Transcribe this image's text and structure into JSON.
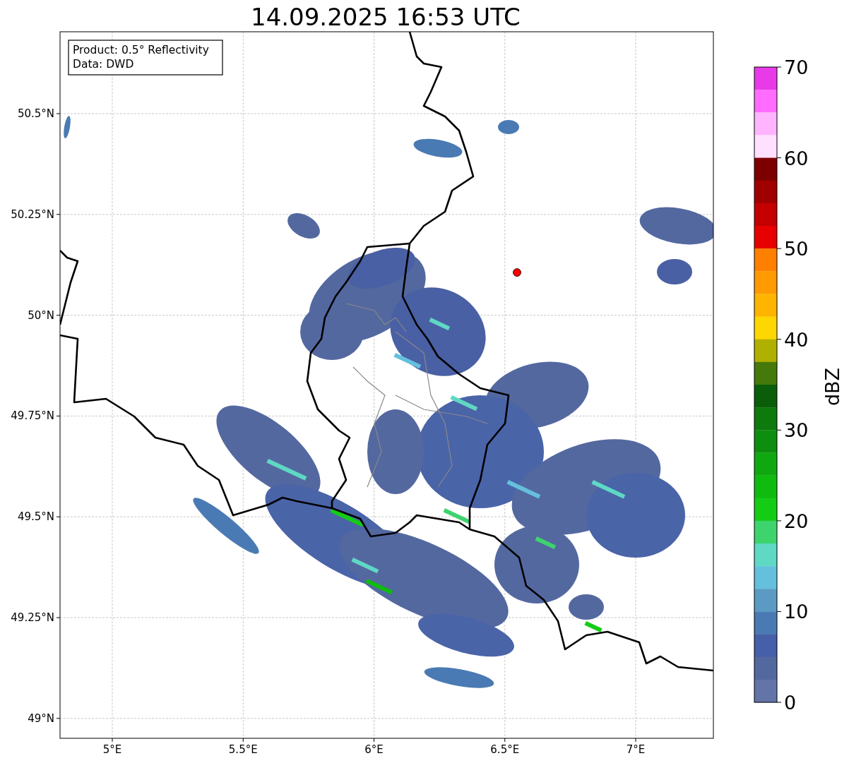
{
  "title": "14.09.2025 16:53 UTC",
  "info_box": [
    "Product: 0.5° Reflectivity",
    "Data: DWD"
  ],
  "x_ticks": [
    "5°E",
    "5.5°E",
    "6°E",
    "6.5°E",
    "7°E"
  ],
  "y_ticks": [
    "50.5°N",
    "50.25°N",
    "50°N",
    "49.75°N",
    "49.5°N",
    "49.25°N",
    "49°N"
  ],
  "colorbar": {
    "label": "dBZ",
    "ticks": [
      "70",
      "60",
      "50",
      "40",
      "30",
      "20",
      "10",
      "0"
    ],
    "bins": [
      {
        "color": "#e83ae8"
      },
      {
        "color": "#ff6cff"
      },
      {
        "color": "#ffb4ff"
      },
      {
        "color": "#ffe0ff"
      },
      {
        "color": "#7d0000"
      },
      {
        "color": "#a00000"
      },
      {
        "color": "#c40000"
      },
      {
        "color": "#e60000"
      },
      {
        "color": "#ff7f00"
      },
      {
        "color": "#ff9a00"
      },
      {
        "color": "#ffb400"
      },
      {
        "color": "#ffd700"
      },
      {
        "color": "#b0b000"
      },
      {
        "color": "#457a0a"
      },
      {
        "color": "#0a5e0a"
      },
      {
        "color": "#0c7a0c"
      },
      {
        "color": "#0e8e0e"
      },
      {
        "color": "#10a810"
      },
      {
        "color": "#10bb10"
      },
      {
        "color": "#14cc14"
      },
      {
        "color": "#3dd46e"
      },
      {
        "color": "#5fd8c4"
      },
      {
        "color": "#64c0dc"
      },
      {
        "color": "#5a9ac4"
      },
      {
        "color": "#4a7ab4"
      },
      {
        "color": "#4560a8"
      },
      {
        "color": "#5468a0"
      },
      {
        "color": "#6374a8"
      }
    ]
  }
}
